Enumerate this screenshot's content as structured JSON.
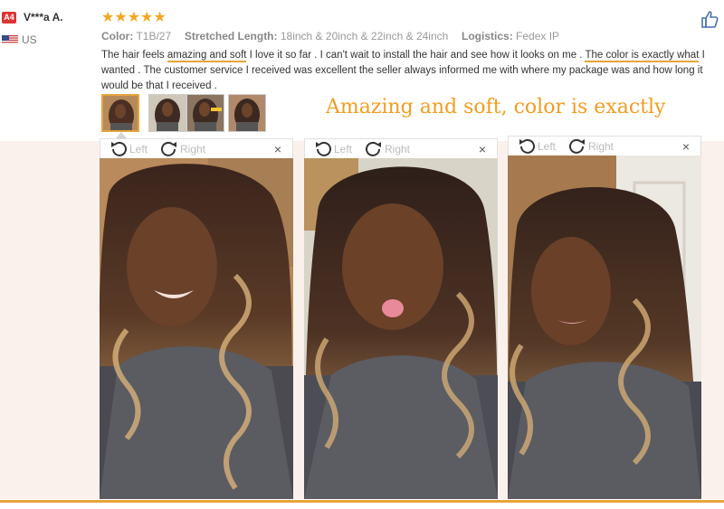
{
  "reviewer": {
    "badge": "A4",
    "name": "V***a A.",
    "country": "US",
    "rating_stars": "★★★★★",
    "rating": 5
  },
  "specs": {
    "color_label": "Color:",
    "color_value": "T1B/27",
    "length_label": "Stretched Length:",
    "length_value": "18inch & 20inch & 22inch & 24inch",
    "logistics_label": "Logistics:",
    "logistics_value": "Fedex IP"
  },
  "review": {
    "p1": "The hair feels ",
    "u1": "amazing and soft",
    "p2": " I love it so far . I can't wait to install the hair and see how it looks on me . ",
    "u2": "The color is exactly what",
    "p3": " I wanted . The customer service I received was excellent the seller always informed me with where my package was and how long it would be that I received ."
  },
  "caption": "Amazing and soft, color is exactly",
  "viewer": {
    "left_label": "Left",
    "right_label": "Right",
    "close_glyph": "×"
  },
  "icons": {
    "like": "thumbs-up-icon",
    "flag": "us-flag-icon",
    "rotate_left": "rotate-left-icon",
    "rotate_right": "rotate-right-icon",
    "close": "close-icon"
  },
  "colors": {
    "accent": "#e7a43c",
    "star": "#f5a623",
    "caption": "#f39c1f"
  }
}
